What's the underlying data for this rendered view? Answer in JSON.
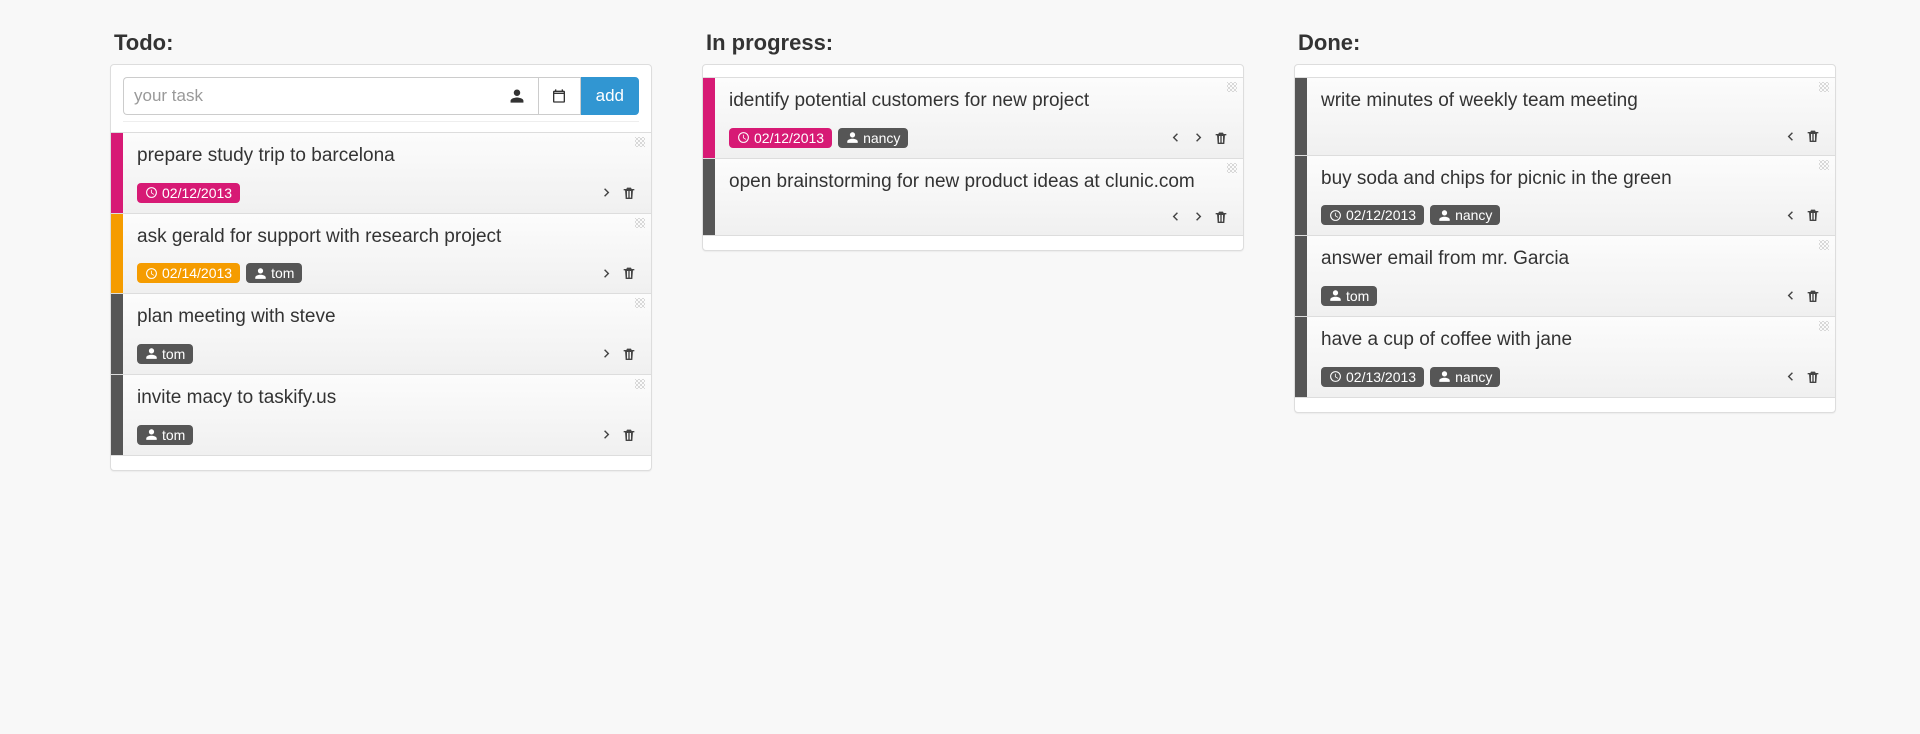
{
  "columns": {
    "todo": {
      "title": "Todo:"
    },
    "inprogress": {
      "title": "In progress:"
    },
    "done": {
      "title": "Done:"
    }
  },
  "input": {
    "value": "",
    "placeholder": "your task",
    "add_label": "add"
  },
  "colors": {
    "magenta": "#d71a75",
    "orange": "#f59c00",
    "grey": "#565656"
  },
  "cards": {
    "todo": [
      {
        "id": "t1",
        "title": "prepare study trip to barcelona",
        "stripe": "magenta",
        "due": "02/12/2013",
        "due_color": "magenta",
        "assignee": null,
        "nav": [
          "next"
        ]
      },
      {
        "id": "t2",
        "title": "ask gerald for support with research project",
        "stripe": "orange",
        "due": "02/14/2013",
        "due_color": "orange",
        "assignee": "tom",
        "nav": [
          "next"
        ]
      },
      {
        "id": "t3",
        "title": "plan meeting with steve",
        "stripe": "grey",
        "due": null,
        "due_color": null,
        "assignee": "tom",
        "nav": [
          "next"
        ]
      },
      {
        "id": "t4",
        "title": "invite macy to taskify.us",
        "stripe": "grey",
        "due": null,
        "due_color": null,
        "assignee": "tom",
        "nav": [
          "next"
        ]
      }
    ],
    "inprogress": [
      {
        "id": "p1",
        "title": "identify potential customers for new project",
        "stripe": "magenta",
        "due": "02/12/2013",
        "due_color": "magenta",
        "assignee": "nancy",
        "nav": [
          "prev",
          "next"
        ]
      },
      {
        "id": "p2",
        "title": "open brainstorming for new product ideas at clunic.com",
        "stripe": "grey",
        "due": null,
        "due_color": null,
        "assignee": null,
        "nav": [
          "prev",
          "next"
        ]
      }
    ],
    "done": [
      {
        "id": "d1",
        "title": "write minutes of weekly team meeting",
        "stripe": "grey",
        "due": null,
        "due_color": null,
        "assignee": null,
        "nav": [
          "prev"
        ]
      },
      {
        "id": "d2",
        "title": "buy soda and chips for picnic in the green",
        "stripe": "grey",
        "due": "02/12/2013",
        "due_color": "grey",
        "assignee": "nancy",
        "nav": [
          "prev"
        ]
      },
      {
        "id": "d3",
        "title": "answer email from mr. Garcia",
        "stripe": "grey",
        "due": null,
        "due_color": null,
        "assignee": "tom",
        "nav": [
          "prev"
        ]
      },
      {
        "id": "d4",
        "title": "have a cup of coffee with jane",
        "stripe": "grey",
        "due": "02/13/2013",
        "due_color": "grey",
        "assignee": "nancy",
        "nav": [
          "prev"
        ]
      }
    ]
  }
}
